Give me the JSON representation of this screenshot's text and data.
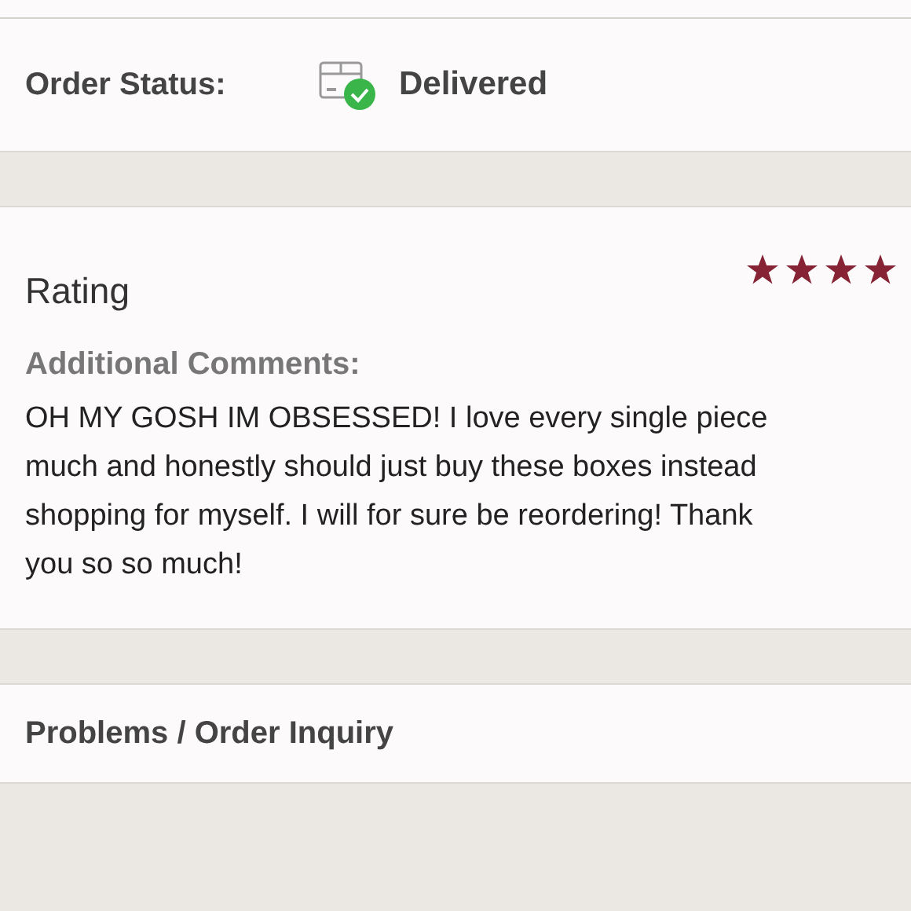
{
  "order_status": {
    "label": "Order Status:",
    "value": "Delivered"
  },
  "rating": {
    "title": "Rating",
    "stars": 4,
    "comments_label": "Additional Comments:",
    "comment_lines": [
      "OH MY GOSH IM OBSESSED! I love every single piece",
      "much and honestly should just buy these boxes instead",
      "shopping for myself. I will for sure be reordering! Thank",
      "you so so much!"
    ]
  },
  "problems": {
    "label": "Problems / Order Inquiry"
  }
}
